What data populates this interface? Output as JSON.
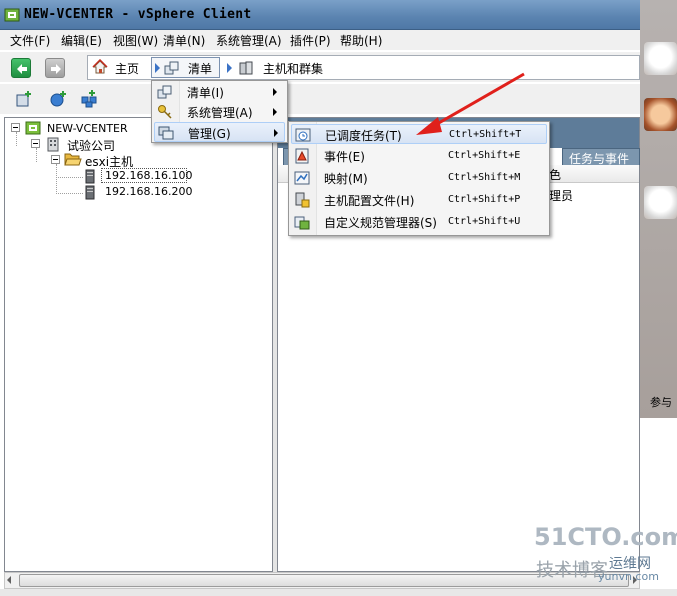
{
  "window": {
    "title": "NEW-VCENTER - vSphere Client"
  },
  "menubar": [
    {
      "label": "文件(F)"
    },
    {
      "label": "编辑(E)"
    },
    {
      "label": "视图(W)"
    },
    {
      "label": "清单(N)"
    },
    {
      "label": "系统管理(A)"
    },
    {
      "label": "插件(P)"
    },
    {
      "label": "帮助(H)"
    }
  ],
  "nav": {
    "home": "主页",
    "inventory": "清单",
    "hosts_clusters": "主机和群集"
  },
  "tree": {
    "root": "NEW-VCENTER",
    "datacenter": "试验公司",
    "cluster": "esxi主机",
    "hosts": [
      "192.168.16.100",
      "192.168.16.200"
    ]
  },
  "right_panel": {
    "tab_right": "任务与事件",
    "col1_fragment": "色",
    "row1_fragment": "理员"
  },
  "inventory_menu": [
    {
      "label": "清单(I)"
    },
    {
      "label": "系统管理(A)"
    },
    {
      "label": "管理(G)"
    }
  ],
  "manage_submenu": [
    {
      "label": "已调度任务(T)",
      "shortcut": "Ctrl+Shift+T"
    },
    {
      "label": "事件(E)",
      "shortcut": "Ctrl+Shift+E"
    },
    {
      "label": "映射(M)",
      "shortcut": "Ctrl+Shift+M"
    },
    {
      "label": "主机配置文件(H)",
      "shortcut": "Ctrl+Shift+P"
    },
    {
      "label": "自定义规范管理器(S)",
      "shortcut": "Ctrl+Shift+U"
    }
  ],
  "right_strip": {
    "text": "参与"
  },
  "watermark": {
    "line1": "51CTO.com",
    "line2": "技术博客",
    "line3": "运维网",
    "line4": "yunvn.com"
  },
  "colors": {
    "arrow": "#e0201b",
    "titlebar": "#5a83b0",
    "menu_highlight": "#d7e3f4"
  }
}
